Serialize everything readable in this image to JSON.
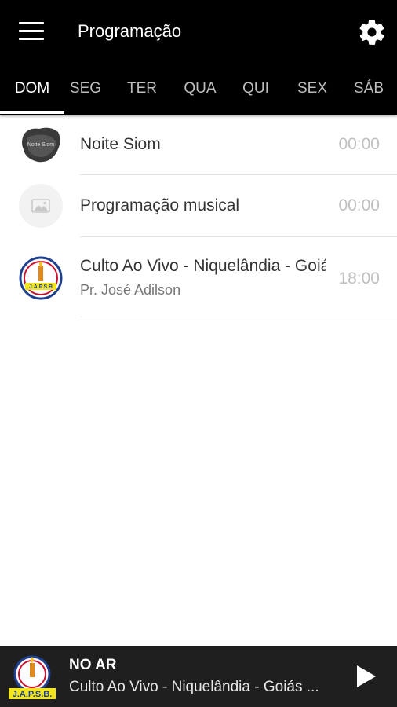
{
  "appbar": {
    "title": "Programação",
    "menu_icon": "hamburger-menu-icon",
    "settings_icon": "gear-icon",
    "background": "#000000"
  },
  "tabs": [
    {
      "label": "DOM",
      "active": true
    },
    {
      "label": "SEG",
      "active": false
    },
    {
      "label": "TER",
      "active": false
    },
    {
      "label": "QUA",
      "active": false
    },
    {
      "label": "QUI",
      "active": false
    },
    {
      "label": "SEX",
      "active": false
    },
    {
      "label": "SÁB",
      "active": false
    }
  ],
  "schedule": [
    {
      "name": "Noite Siom",
      "presenter": "",
      "time": "00:00",
      "thumb_text": "Noite Siom"
    },
    {
      "name": "Programação musical",
      "presenter": "",
      "time": "00:00",
      "thumb_text": ""
    },
    {
      "name": "Culto Ao Vivo - Niquelândia - Goiás",
      "presenter": "Pr. José Adilson",
      "time": "18:00",
      "thumb_text": "J.A.P.S.B"
    }
  ],
  "player": {
    "status": "NO AR",
    "now_playing": "Culto Ao Vivo - Niquelândia - Goiás ...",
    "logo_text": "J.A.P.S.B.",
    "play_icon": "play-icon"
  }
}
